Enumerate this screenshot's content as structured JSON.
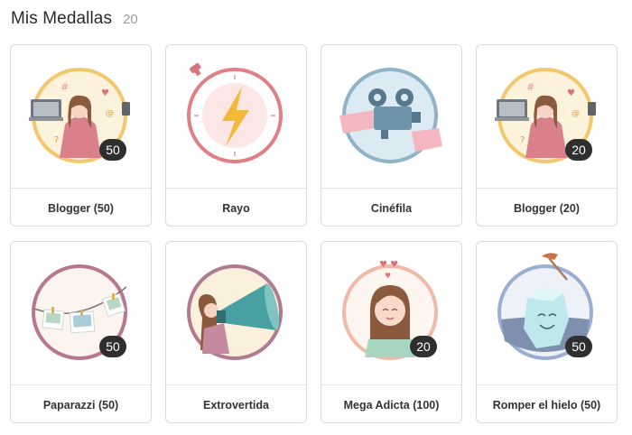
{
  "header": {
    "title": "Mis Medallas",
    "count": "20"
  },
  "medals": [
    {
      "label": "Blogger (50)",
      "badge": "50",
      "icon": "blogger-medal-icon"
    },
    {
      "label": "Rayo",
      "badge": "",
      "icon": "lightning-medal-icon"
    },
    {
      "label": "Cinéfila",
      "badge": "",
      "icon": "film-projector-medal-icon"
    },
    {
      "label": "Blogger (20)",
      "badge": "20",
      "icon": "blogger-medal-icon"
    },
    {
      "label": "Paparazzi (50)",
      "badge": "50",
      "icon": "photos-clothesline-medal-icon"
    },
    {
      "label": "Extrovertida",
      "badge": "",
      "icon": "megaphone-medal-icon"
    },
    {
      "label": "Mega Adicta (100)",
      "badge": "20",
      "icon": "girl-hearts-medal-icon"
    },
    {
      "label": "Romper el hielo (50)",
      "badge": "50",
      "icon": "ice-cube-medal-icon"
    }
  ],
  "colors": {
    "blogger_ring": "#f3c76d",
    "rayo_ring": "#e07f86",
    "cinefila_ring": "#8fb3c8",
    "paparazzi_ring": "#b9768e",
    "extrovertida_ring": "#b17b8f",
    "mega_ring": "#f0b9a8",
    "hielo_ring": "#9aaed3"
  }
}
